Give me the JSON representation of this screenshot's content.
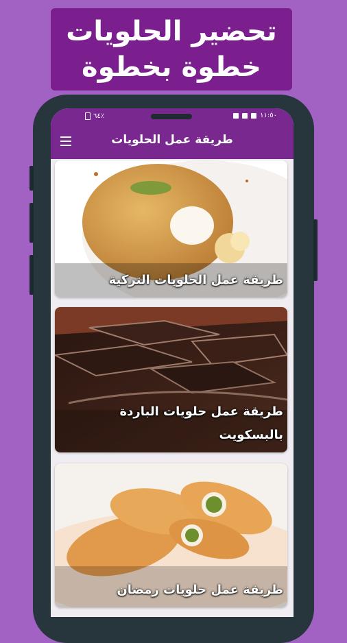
{
  "banner": {
    "line1": "تحضير الحلويات",
    "line2": "خطوة بخطوة"
  },
  "status": {
    "left": "٦٤٪",
    "time": "١١:٥٠"
  },
  "app": {
    "title": "طريقة عمل الحلويات"
  },
  "cards": [
    {
      "label": "طريقة عمل الحلويات التركية"
    },
    {
      "label": "طريقة عمل حلويات الباردة بالبسكويت"
    },
    {
      "label": "طريقة عمل حلويات رمضان"
    }
  ],
  "icons": {
    "menu": "menu-icon",
    "battery": "battery-icon",
    "image": "image-icon",
    "check": "check-icon"
  },
  "colors": {
    "background": "#a262c4",
    "banner": "#7b1f8e",
    "appbar": "#78288f",
    "phone_frame": "#26363c"
  }
}
